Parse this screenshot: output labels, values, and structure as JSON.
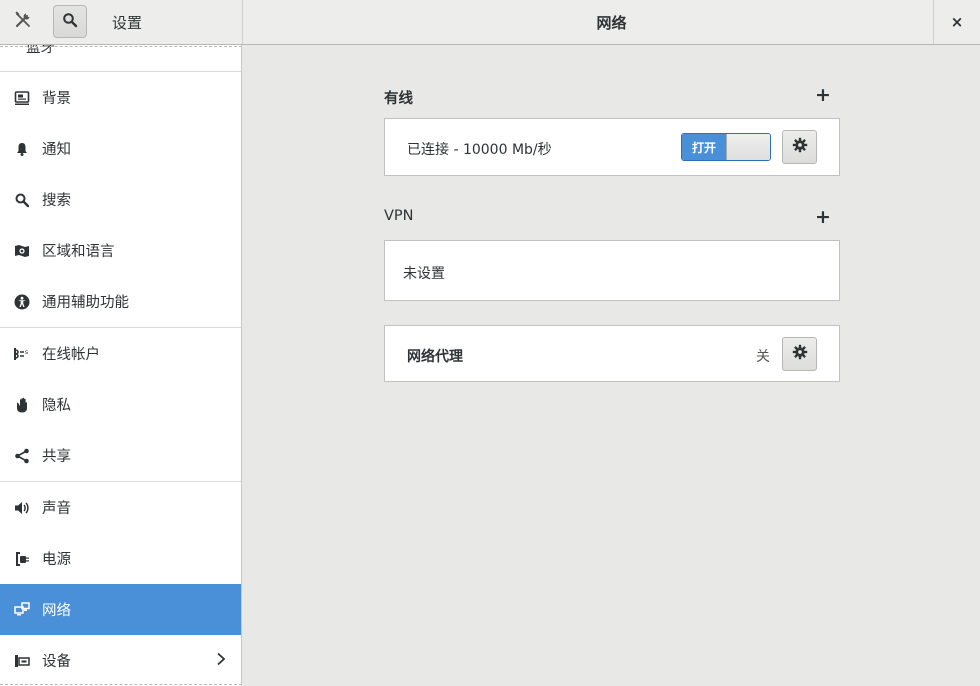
{
  "header": {
    "app_title": "设置",
    "panel_title": "网络",
    "close_label": "×"
  },
  "sidebar": {
    "partial_item": "蓝牙",
    "items": [
      {
        "label": "背景",
        "icon": "background-icon"
      },
      {
        "label": "通知",
        "icon": "bell-icon"
      },
      {
        "label": "搜索",
        "icon": "search-icon"
      },
      {
        "label": "区域和语言",
        "icon": "region-icon"
      },
      {
        "label": "通用辅助功能",
        "icon": "accessibility-icon"
      },
      {
        "label": "在线帐户",
        "icon": "online-accounts-icon"
      },
      {
        "label": "隐私",
        "icon": "hand-icon"
      },
      {
        "label": "共享",
        "icon": "share-icon"
      },
      {
        "label": "声音",
        "icon": "speaker-icon"
      },
      {
        "label": "电源",
        "icon": "power-icon"
      },
      {
        "label": "网络",
        "icon": "network-icon",
        "selected": true
      },
      {
        "label": "设备",
        "icon": "devices-icon",
        "has_arrow": true
      }
    ]
  },
  "main": {
    "wired": {
      "title": "有线",
      "status": "已连接 - 10000 Mb/秒",
      "switch_label": "打开",
      "switch_on": true
    },
    "vpn": {
      "title": "VPN",
      "empty_text": "未设置"
    },
    "proxy": {
      "label": "网络代理",
      "status": "关"
    }
  },
  "colors": {
    "accent": "#4a90d9",
    "background": "#e8e8e7",
    "sidebar": "#ffffff",
    "text": "#2e3436"
  }
}
